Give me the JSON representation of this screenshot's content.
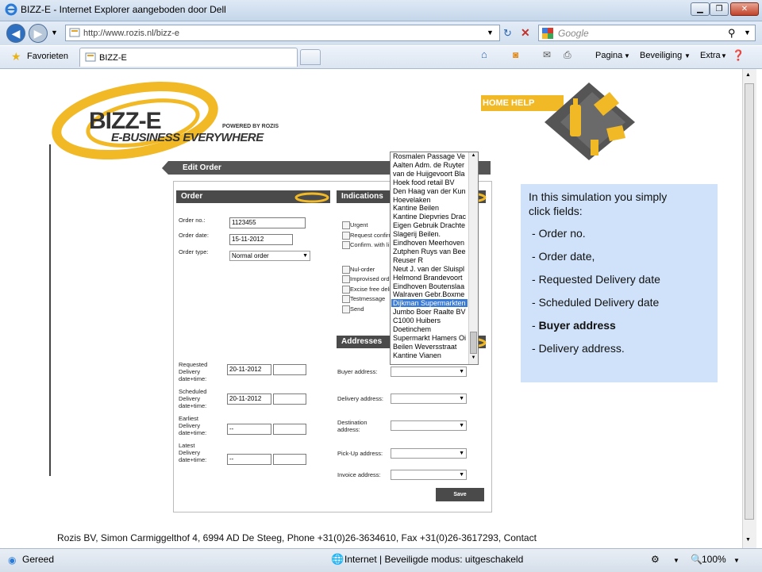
{
  "window": {
    "title": "BIZZ-E - Internet Explorer aangeboden door Dell"
  },
  "address_bar": {
    "url": "http://www.rozis.nl/bizz-e",
    "search_placeholder": "Google"
  },
  "favorites_bar": {
    "favorites_label": "Favorieten",
    "tab_label": "BIZZ-E",
    "commands": [
      "Pagina",
      "Beveiliging",
      "Extra"
    ]
  },
  "page": {
    "logo": {
      "name": "BIZZ-E",
      "tagline": "E-BUSINESS EVERYWHERE",
      "powered_by": "POWERED BY ROZIS"
    },
    "home_help": "HOME HELP",
    "edit_order_title": "Edit Order",
    "order_section": {
      "title": "Order",
      "order_no_label": "Order no.:",
      "order_no_value": "1123455",
      "order_date_label": "Order date:",
      "order_date_value": "15-11-2012",
      "order_type_label": "Order type:",
      "order_type_value": "Normal order"
    },
    "indications_section": {
      "title": "Indications",
      "checkboxes": [
        "Urgent",
        "Request confirm",
        "Confirm. with li",
        "Nul-order",
        "Improvised ord",
        "Excise free deli",
        "Testmessage",
        "Send"
      ]
    },
    "dates": {
      "requested_label": "Requested Delivery date+time:",
      "requested_value": "20-11-2012",
      "scheduled_label": "Scheduled Delivery date+time:",
      "scheduled_value": "20-11-2012",
      "earliest_label": "Earliest Delivery date+time:",
      "earliest_value": "--",
      "latest_label": "Latest Delivery date+time:",
      "latest_value": "--"
    },
    "addresses_section": {
      "title": "Addresses",
      "buyer_label": "Buyer address:",
      "delivery_label": "Delivery address:",
      "destination_label": "Destination address:",
      "pickup_label": "Pick-Up address:",
      "invoice_label": "Invoice address:"
    },
    "dropdown_options": [
      "Rosmalen Passage Ve",
      "Aalten Adm. de Ruyter",
      "van de Huijgevoort Bla",
      "Hoek food retail BV",
      "Den Haag van der Kun",
      "Hoevelaken",
      "Kantine Beilen",
      "Kantine Diepvries Drac",
      "Eigen Gebruik Drachte",
      "Slagerij Beilen.",
      "Eindhoven Meerhoven",
      "Zutphen Ruys van Bee",
      "Reuser R",
      "Neut J. van der Sluispl",
      "Helmond Brandevoort",
      "Eindhoven Boutenslaa",
      "Walraven Gebr.Boxme",
      "Dijkman Supermarkten",
      "Jumbo Boer Raalte BV",
      "C1000 Huibers",
      "Doetinchem",
      "Supermarkt Hamers Oi",
      "Beilen Weversstraat",
      "Kantine Vianen"
    ],
    "dropdown_selected_index": 17,
    "save_label": "Save",
    "info_box": {
      "intro_line1": "In this simulation you simply",
      "intro_line2": "click fields:",
      "items": [
        "Order no.",
        "Order date,",
        "Requested Delivery date",
        "Scheduled Delivery date",
        "Buyer address",
        "Delivery address."
      ],
      "highlighted_index": 4
    },
    "footer": "Rozis BV, Simon Carmiggelthof 4, 6994 AD De Steeg, Phone +31(0)26-3634610, Fax +31(0)26-3617293, Contact"
  },
  "status_bar": {
    "status": "Gereed",
    "zone": "Internet | Beveiligde modus: uitgeschakeld",
    "zoom": "100%"
  },
  "colors": {
    "brand_yellow": "#f2b927",
    "dark_bar": "#4a4a4a",
    "info_bg": "#cfe2f9",
    "selection": "#3a7bd5"
  }
}
